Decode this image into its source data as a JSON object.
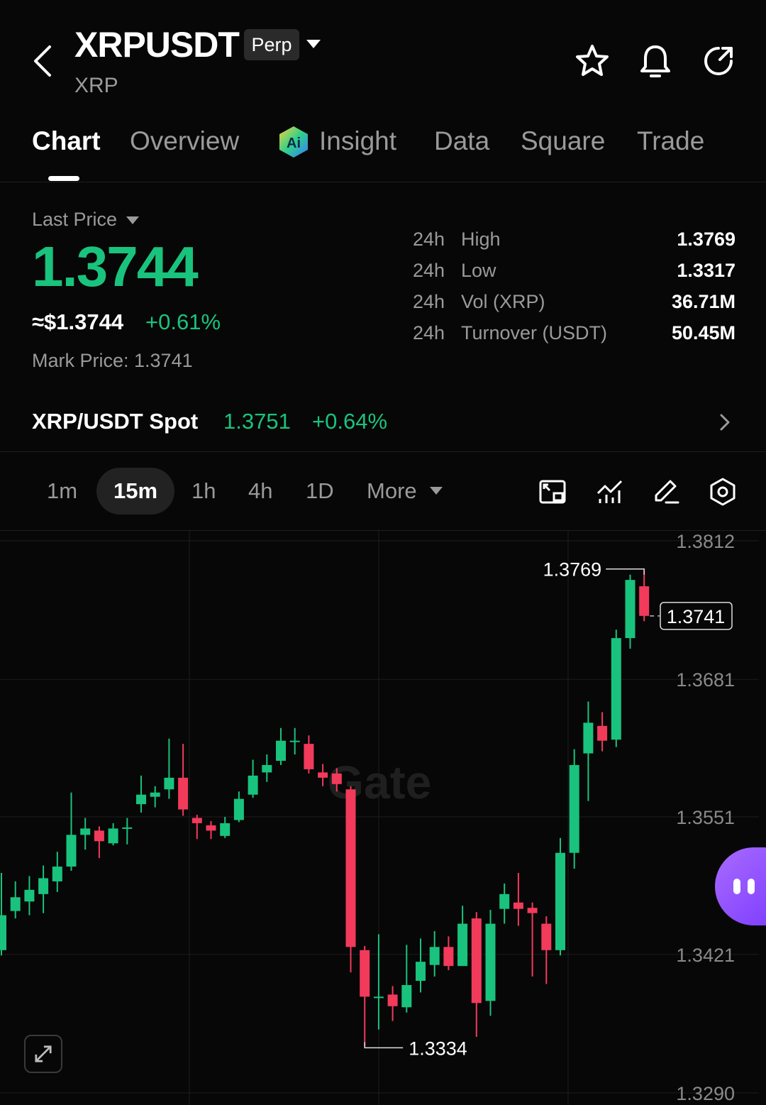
{
  "header": {
    "symbol": "XRPUSDT",
    "contract_type": "Perp",
    "base_asset": "XRP"
  },
  "tabs": [
    {
      "label": "Chart",
      "active": true
    },
    {
      "label": "Overview",
      "active": false
    },
    {
      "label": "Insight",
      "active": false
    },
    {
      "label": "Data",
      "active": false
    },
    {
      "label": "Square",
      "active": false
    },
    {
      "label": "Trade",
      "active": false
    }
  ],
  "price": {
    "last_price_label": "Last Price",
    "last_price": "1.3744",
    "usd_price": "≈$1.3744",
    "change_pct": "+0.61%",
    "mark_price": "Mark Price: 1.3741"
  },
  "stats": [
    {
      "period": "24h",
      "name": "High",
      "value": "1.3769"
    },
    {
      "period": "24h",
      "name": "Low",
      "value": "1.3317"
    },
    {
      "period": "24h",
      "name": "Vol (XRP)",
      "value": "36.71M"
    },
    {
      "period": "24h",
      "name": "Turnover (USDT)",
      "value": "50.45M"
    }
  ],
  "spot": {
    "label": "XRP/USDT Spot",
    "price": "1.3751",
    "change": "+0.64%"
  },
  "intervals": [
    "1m",
    "15m",
    "1h",
    "4h",
    "1D",
    "More"
  ],
  "active_interval": "15m",
  "colors": {
    "up": "#19c37d",
    "down": "#f23a5b",
    "background": "#070707"
  },
  "chart_data": {
    "type": "candlestick",
    "watermark": "Gate",
    "y_ticks": [
      1.3812,
      1.3681,
      1.3551,
      1.3421,
      1.329
    ],
    "ylim": [
      1.329,
      1.3812
    ],
    "high_label": "1.3769",
    "low_label": "1.3334",
    "current_price_label": "1.3741",
    "candles": [
      {
        "o": 1.3425,
        "c": 1.3458,
        "h": 1.3498,
        "l": 1.342
      },
      {
        "o": 1.3462,
        "c": 1.3475,
        "h": 1.349,
        "l": 1.3455
      },
      {
        "o": 1.3471,
        "c": 1.3482,
        "h": 1.3495,
        "l": 1.3458
      },
      {
        "o": 1.3478,
        "c": 1.3493,
        "h": 1.3505,
        "l": 1.346
      },
      {
        "o": 1.349,
        "c": 1.3504,
        "h": 1.3518,
        "l": 1.348
      },
      {
        "o": 1.3504,
        "c": 1.3534,
        "h": 1.3574,
        "l": 1.35
      },
      {
        "o": 1.3534,
        "c": 1.354,
        "h": 1.355,
        "l": 1.352
      },
      {
        "o": 1.3538,
        "c": 1.3528,
        "h": 1.3542,
        "l": 1.3512
      },
      {
        "o": 1.3526,
        "c": 1.354,
        "h": 1.3545,
        "l": 1.3524
      },
      {
        "o": 1.354,
        "c": 1.3541,
        "h": 1.355,
        "l": 1.3525
      },
      {
        "o": 1.3563,
        "c": 1.3572,
        "h": 1.359,
        "l": 1.3555
      },
      {
        "o": 1.357,
        "c": 1.3574,
        "h": 1.358,
        "l": 1.356
      },
      {
        "o": 1.3577,
        "c": 1.3588,
        "h": 1.3625,
        "l": 1.3568
      },
      {
        "o": 1.3588,
        "c": 1.3558,
        "h": 1.362,
        "l": 1.3552
      },
      {
        "o": 1.355,
        "c": 1.3545,
        "h": 1.3553,
        "l": 1.353
      },
      {
        "o": 1.3543,
        "c": 1.3538,
        "h": 1.3547,
        "l": 1.353
      },
      {
        "o": 1.3533,
        "c": 1.3545,
        "h": 1.3551,
        "l": 1.3531
      },
      {
        "o": 1.3548,
        "c": 1.3568,
        "h": 1.3575,
        "l": 1.3546
      },
      {
        "o": 1.3572,
        "c": 1.359,
        "h": 1.3605,
        "l": 1.3569
      },
      {
        "o": 1.3593,
        "c": 1.36,
        "h": 1.361,
        "l": 1.3584
      },
      {
        "o": 1.3604,
        "c": 1.3623,
        "h": 1.3635,
        "l": 1.36
      },
      {
        "o": 1.3623,
        "c": 1.3623,
        "h": 1.3635,
        "l": 1.361
      },
      {
        "o": 1.362,
        "c": 1.3596,
        "h": 1.3628,
        "l": 1.3592
      },
      {
        "o": 1.3593,
        "c": 1.3588,
        "h": 1.3601,
        "l": 1.358
      },
      {
        "o": 1.3592,
        "c": 1.3582,
        "h": 1.3597,
        "l": 1.3575
      },
      {
        "o": 1.3577,
        "c": 1.3428,
        "h": 1.358,
        "l": 1.3404
      },
      {
        "o": 1.3425,
        "c": 1.3381,
        "h": 1.3429,
        "l": 1.3334
      },
      {
        "o": 1.3381,
        "c": 1.3381,
        "h": 1.344,
        "l": 1.335
      },
      {
        "o": 1.3383,
        "c": 1.3372,
        "h": 1.3391,
        "l": 1.3358
      },
      {
        "o": 1.3371,
        "c": 1.3392,
        "h": 1.343,
        "l": 1.3366
      },
      {
        "o": 1.3396,
        "c": 1.3414,
        "h": 1.3436,
        "l": 1.3385
      },
      {
        "o": 1.3411,
        "c": 1.3428,
        "h": 1.3443,
        "l": 1.34
      },
      {
        "o": 1.3428,
        "c": 1.341,
        "h": 1.3438,
        "l": 1.3406
      },
      {
        "o": 1.341,
        "c": 1.345,
        "h": 1.3467,
        "l": 1.341
      },
      {
        "o": 1.3455,
        "c": 1.3375,
        "h": 1.3461,
        "l": 1.3343
      },
      {
        "o": 1.3377,
        "c": 1.345,
        "h": 1.3463,
        "l": 1.3363
      },
      {
        "o": 1.3464,
        "c": 1.3478,
        "h": 1.3488,
        "l": 1.345
      },
      {
        "o": 1.347,
        "c": 1.3464,
        "h": 1.3498,
        "l": 1.3448
      },
      {
        "o": 1.3465,
        "c": 1.346,
        "h": 1.347,
        "l": 1.34
      },
      {
        "o": 1.345,
        "c": 1.3425,
        "h": 1.3457,
        "l": 1.3393
      },
      {
        "o": 1.3425,
        "c": 1.3517,
        "h": 1.3531,
        "l": 1.342
      },
      {
        "o": 1.3517,
        "c": 1.36,
        "h": 1.3615,
        "l": 1.3502
      },
      {
        "o": 1.3611,
        "c": 1.364,
        "h": 1.366,
        "l": 1.3566
      },
      {
        "o": 1.3637,
        "c": 1.3623,
        "h": 1.365,
        "l": 1.3613
      },
      {
        "o": 1.3624,
        "c": 1.372,
        "h": 1.3728,
        "l": 1.3617
      },
      {
        "o": 1.372,
        "c": 1.3775,
        "h": 1.378,
        "l": 1.371
      },
      {
        "o": 1.3769,
        "c": 1.3741,
        "h": 1.3784,
        "l": 1.3736
      }
    ]
  }
}
